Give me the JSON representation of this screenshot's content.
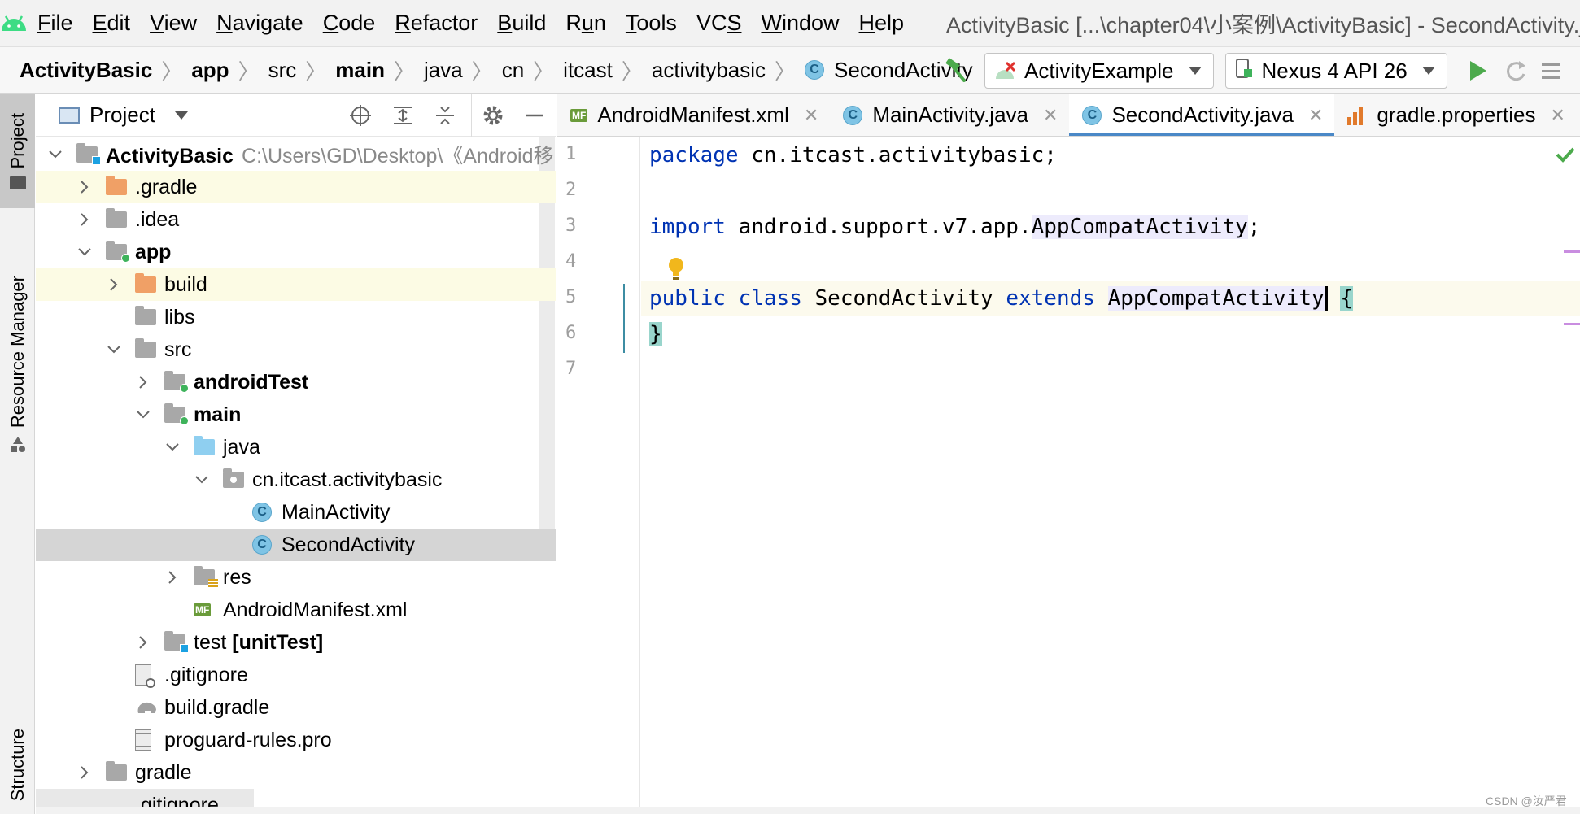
{
  "window": {
    "title": "ActivityBasic [...\\chapter04\\小案例\\ActivityBasic] - SecondActivity.java"
  },
  "menu": {
    "items": [
      {
        "pre": "",
        "mn": "F",
        "post": "ile"
      },
      {
        "pre": "",
        "mn": "E",
        "post": "dit"
      },
      {
        "pre": "",
        "mn": "V",
        "post": "iew"
      },
      {
        "pre": "",
        "mn": "N",
        "post": "avigate"
      },
      {
        "pre": "",
        "mn": "C",
        "post": "ode"
      },
      {
        "pre": "",
        "mn": "R",
        "post": "efactor"
      },
      {
        "pre": "",
        "mn": "B",
        "post": "uild"
      },
      {
        "pre": "R",
        "mn": "u",
        "post": "n"
      },
      {
        "pre": "",
        "mn": "T",
        "post": "ools"
      },
      {
        "pre": "VC",
        "mn": "S",
        "post": ""
      },
      {
        "pre": "",
        "mn": "W",
        "post": "indow"
      },
      {
        "pre": "",
        "mn": "H",
        "post": "elp"
      }
    ]
  },
  "breadcrumb": {
    "items": [
      "ActivityBasic",
      "app",
      "src",
      "main",
      "java",
      "cn",
      "itcast",
      "activitybasic",
      "SecondActivity"
    ],
    "icon_letter": "C"
  },
  "toolbar": {
    "run_config": "ActivityExample",
    "device": "Nexus 4 API 26"
  },
  "side_tabs": {
    "project": "Project",
    "resource_manager": "Resource Manager",
    "structure": "Structure"
  },
  "project_panel": {
    "title": "Project",
    "root_label": "ActivityBasic",
    "root_path": "C:\\Users\\GD\\Desktop\\《Android移",
    "tree": [
      {
        "label": ".gradle"
      },
      {
        "label": ".idea"
      },
      {
        "label": "app"
      },
      {
        "label": "build"
      },
      {
        "label": "libs"
      },
      {
        "label": "src"
      },
      {
        "label": "androidTest"
      },
      {
        "label": "main"
      },
      {
        "label": "java"
      },
      {
        "label": "cn.itcast.activitybasic"
      },
      {
        "label": "MainActivity"
      },
      {
        "label": "SecondActivity"
      },
      {
        "label": "res"
      },
      {
        "label": "AndroidManifest.xml"
      },
      {
        "label": "test",
        "suffix": "[unitTest]"
      },
      {
        "label": ".gitignore"
      },
      {
        "label": "build.gradle"
      },
      {
        "label": "proguard-rules.pro"
      },
      {
        "label": "gradle"
      },
      {
        "label": ".gitignore"
      }
    ]
  },
  "editor": {
    "tabs": [
      {
        "label": "AndroidManifest.xml",
        "icon_text": "MF"
      },
      {
        "label": "MainActivity.java",
        "icon_text": "C"
      },
      {
        "label": "SecondActivity.java",
        "icon_text": "C"
      },
      {
        "label": "gradle.properties"
      }
    ],
    "line_numbers": [
      "1",
      "2",
      "3",
      "4",
      "5",
      "6",
      "7"
    ],
    "code": {
      "l1_kw": "package",
      "l1_rest": " cn.itcast.activitybasic;",
      "l3_kw": "import",
      "l3_pkg": " android.support.v7.app.",
      "l3_type": "AppCompatActivity",
      "l3_end": ";",
      "l5_kw1": "public",
      "l5_kw2": "class",
      "l5_name": "SecondActivity",
      "l5_kw3": "extends",
      "l5_type": "AppCompatActivity",
      "l5_brace": "{",
      "l6_brace": "}"
    }
  },
  "watermark": "CSDN @汝严君",
  "colors": {
    "keyword": "#0033b3",
    "accent_tab": "#4a88c7",
    "android_green": "#3ddc84",
    "run_green": "#4caa4c"
  }
}
